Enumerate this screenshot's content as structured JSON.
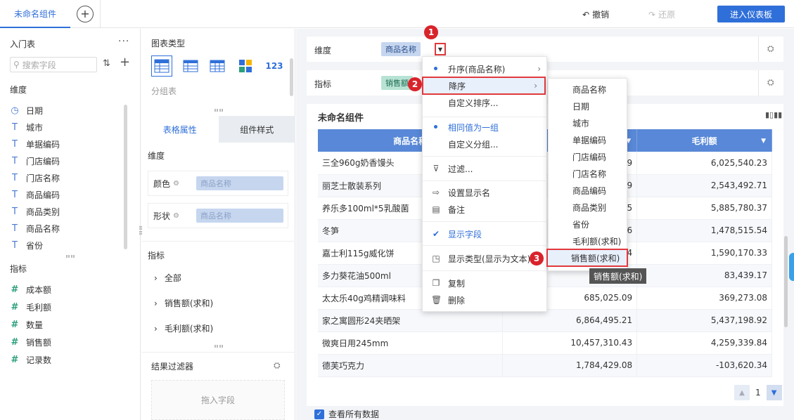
{
  "topbar": {
    "tab_title": "未命名组件",
    "undo_label": "撤销",
    "redo_label": "还原",
    "enter_dashboard": "进入仪表板"
  },
  "left_panel": {
    "title": "入门表",
    "more": "···",
    "search_placeholder": "搜索字段",
    "dimension_label": "维度",
    "dimension_fields": [
      {
        "icon": "clock-icon",
        "label": "日期"
      },
      {
        "icon": "text-icon",
        "label": "城市"
      },
      {
        "icon": "text-icon",
        "label": "单据编码"
      },
      {
        "icon": "text-icon",
        "label": "门店编码"
      },
      {
        "icon": "text-icon",
        "label": "门店名称"
      },
      {
        "icon": "text-icon",
        "label": "商品编码"
      },
      {
        "icon": "text-icon",
        "label": "商品类别"
      },
      {
        "icon": "text-icon",
        "label": "商品名称"
      },
      {
        "icon": "text-icon",
        "label": "省份"
      }
    ],
    "indicator_label": "指标",
    "indicator_fields": [
      {
        "icon": "hash-icon",
        "label": "成本额"
      },
      {
        "icon": "hash-icon",
        "label": "毛利额"
      },
      {
        "icon": "hash-icon",
        "label": "数量"
      },
      {
        "icon": "hash-icon",
        "label": "销售额"
      },
      {
        "icon": "hash-icon",
        "label": "记录数"
      }
    ]
  },
  "mid_panel": {
    "chart_type_label": "图表类型",
    "chart_type_selected": "分组表",
    "tabs": [
      "表格属性",
      "组件样式"
    ],
    "dimension_label": "维度",
    "color_label": "颜色",
    "color_chip": "商品名称",
    "shape_label": "形状",
    "shape_chip": "商品名称",
    "indicator_label": "指标",
    "indicator_items": [
      "全部",
      "销售额(求和)",
      "毛利额(求和)"
    ],
    "result_filter_label": "结果过滤器",
    "drop_field": "拖入字段"
  },
  "right": {
    "dim_label": "维度",
    "dim_chip": "商品名称",
    "ind_label": "指标",
    "ind_chip": "销售额",
    "widget_title": "未命名组件",
    "table": {
      "headers": [
        "商品名称",
        "",
        "毛利额"
      ],
      "rows": [
        [
          "三全960g奶香馒头",
          "09",
          "6,025,540.23"
        ],
        [
          "丽芝士散装系列",
          "9",
          "2,543,492.71"
        ],
        [
          "养乐多100ml*5乳酸菌",
          "55",
          "5,885,780.37"
        ],
        [
          "冬笋",
          "56",
          "1,478,515.54"
        ],
        [
          "嘉士利115g威化饼",
          "4",
          "1,590,170.33"
        ],
        [
          "多力葵花油500ml",
          "",
          "83,439.17"
        ],
        [
          "太太乐40g鸡精调味料",
          "685,025.09",
          "369,273.08"
        ],
        [
          "家之寓圆形24夹晒架",
          "6,864,495.21",
          "5,437,198.92"
        ],
        [
          "微爽日用245mm",
          "10,457,310.43",
          "4,259,339.84"
        ],
        [
          "德芙巧克力",
          "1,784,429.08",
          "-103,620.34"
        ]
      ]
    },
    "page_number": "1",
    "view_all": "查看所有数据"
  },
  "context_menu": {
    "items": [
      {
        "label": "升序(商品名称)",
        "kind": "dot-arrow"
      },
      {
        "label": "降序",
        "kind": "arrow-hl"
      },
      {
        "label": "自定义排序...",
        "kind": "plain"
      },
      {
        "label": "相同值为一组",
        "kind": "dot-blue"
      },
      {
        "label": "自定义分组...",
        "kind": "plain"
      },
      {
        "label": "过滤...",
        "kind": "filter-icon"
      },
      {
        "label": "设置显示名",
        "kind": "rename-icon"
      },
      {
        "label": "备注",
        "kind": "note-icon"
      },
      {
        "label": "显示字段",
        "kind": "check-blue"
      },
      {
        "label": "显示类型(显示为文本)",
        "kind": "display-icon"
      },
      {
        "label": "复制",
        "kind": "copy-icon"
      },
      {
        "label": "删除",
        "kind": "trash-icon"
      }
    ]
  },
  "sub_menu": {
    "items": [
      "商品名称",
      "日期",
      "城市",
      "单据编码",
      "门店编码",
      "门店名称",
      "商品编码",
      "商品类别",
      "省份",
      "毛利额(求和)",
      "销售额(求和)"
    ],
    "highlighted": "销售额(求和)",
    "tooltip": "销售额(求和)"
  },
  "badges": [
    "1",
    "2",
    "3"
  ],
  "colors": {
    "accent": "#2f6fd9",
    "header_blue": "#5888d7",
    "callout_red": "#d9232b"
  }
}
